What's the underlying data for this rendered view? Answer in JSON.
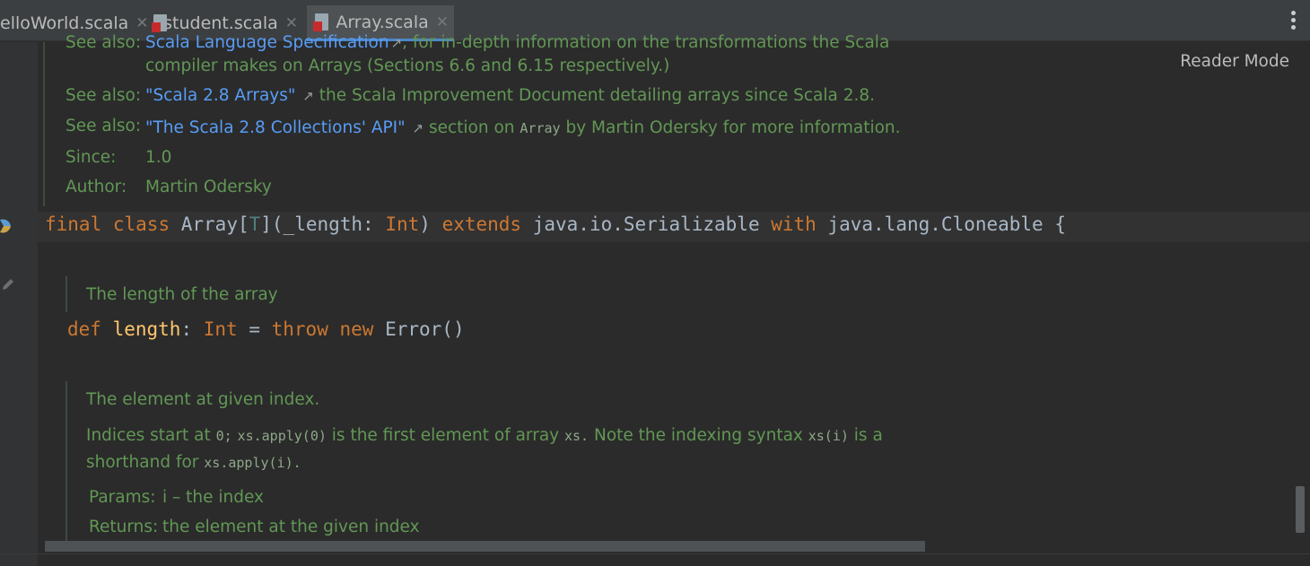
{
  "tabs": [
    {
      "label": "elloWorld.scala",
      "active": false
    },
    {
      "label": "student.scala",
      "active": false
    },
    {
      "label": "Array.scala",
      "active": true
    }
  ],
  "reader_mode": "Reader Mode",
  "doc_top": {
    "line1_label": "See also:",
    "line1_link": "Scala Language Specification",
    "line1_text": ", for in-depth information on the transformations the Scala",
    "line1_cont": "compiler makes on Arrays (Sections 6.6 and 6.15 respectively.)",
    "line2_label": "See also:",
    "line2_link": "\"Scala 2.8 Arrays\"",
    "line2_text": "the Scala Improvement Document detailing arrays since Scala 2.8.",
    "line3_label": "See also:",
    "line3_link": "\"The Scala 2.8 Collections' API\"",
    "line3_text_a": "section on",
    "line3_code": "Array",
    "line3_text_b": "by Martin Odersky for more information.",
    "since_label": "Since:",
    "since_value": "1.0",
    "author_label": "Author:",
    "author_value": "Martin Odersky"
  },
  "code_class": {
    "kw_final": "final",
    "kw_class": "class",
    "name": "Array[",
    "tparam": "T",
    "params_a": "](_length: ",
    "type_int": "Int",
    "params_b": ") ",
    "kw_extends": "extends",
    "super1": " java.io.Serializable ",
    "kw_with": "with",
    "super2": " java.lang.Cloneable {"
  },
  "doc_length": {
    "text": "The length of the array"
  },
  "code_length": {
    "kw_def": "def",
    "fn": "length",
    "colon": ": ",
    "type": "Int",
    "eq": " = ",
    "kw_throw": "throw",
    "kw_new": "new",
    "rest": " Error()"
  },
  "doc_apply": {
    "title": "The element at given index.",
    "p1_a": "Indices start at",
    "p1_code1": "0;",
    "p1_code2": "xs.apply(0)",
    "p1_b": "is the first element of array",
    "p1_code3": "xs.",
    "p1_c": "Note the indexing syntax",
    "p1_code4": "xs(i)",
    "p1_d": "is a",
    "p2_a": "shorthand for",
    "p2_code": "xs.apply(i).",
    "params_label": "Params:",
    "params_value": "i – the index",
    "returns_label": "Returns:",
    "returns_value": "the element at the given index"
  },
  "icons": {
    "file_icon": "scala-file-icon",
    "close": "close-icon",
    "external": "external-link-icon"
  }
}
